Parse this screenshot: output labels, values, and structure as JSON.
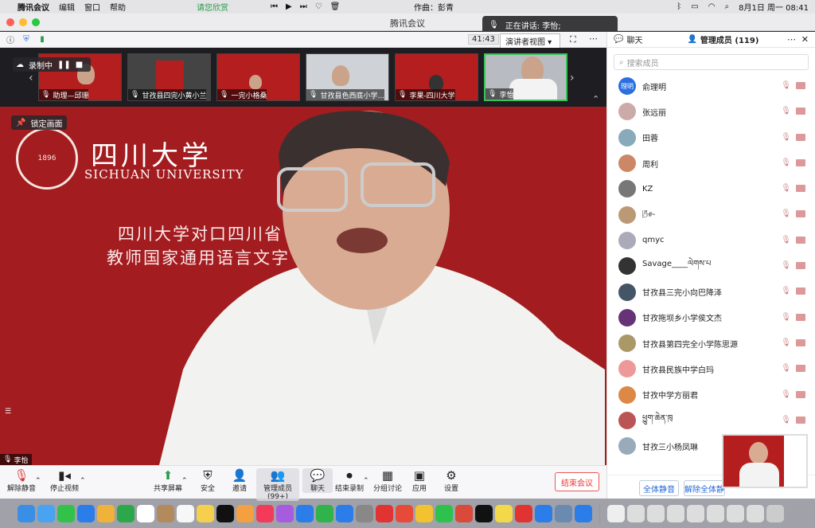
{
  "menubar": {
    "app": "腾讯会议",
    "menus": [
      "编辑",
      "窗口",
      "帮助"
    ],
    "center_text": "请您欣赏",
    "credit": "作曲：彭青",
    "date_time": "8月1日 周一  08:41"
  },
  "window": {
    "title": "腾讯会议",
    "speaking_label": "正在讲话: 李怡;",
    "timer": "41:43",
    "view_mode": "演讲者视图"
  },
  "recording": {
    "label": "录制中"
  },
  "thumbnails": [
    {
      "label": "助理—邱珊"
    },
    {
      "label": "甘孜县四完小黄小兰"
    },
    {
      "label": "一完小格桑"
    },
    {
      "label": "甘孜县色西底小学..."
    },
    {
      "label": "李果-四川大学"
    },
    {
      "label": "李怡"
    }
  ],
  "main": {
    "lock_label": "锁定画面",
    "university_cn": "四川大学",
    "university_en": "SICHUAN UNIVERSITY",
    "seal_year": "1896",
    "slide_line1": "四川大学对口四川省            甘孜县",
    "slide_line2": "教师国家通用语言文字            示范培训",
    "speaker_name": "李怡"
  },
  "toolbar": {
    "mute": "解除静音",
    "video": "停止视频",
    "share": "共享屏幕",
    "security": "安全",
    "invite": "邀请",
    "manage": "管理成员(99+)",
    "chat": "聊天",
    "end_record": "结束录制",
    "breakout": "分组讨论",
    "apps": "应用",
    "settings": "设置",
    "end_meeting": "结束会议"
  },
  "panel": {
    "tab_chat": "聊天",
    "tab_members": "管理成员 (119)",
    "search_placeholder": "搜索成员",
    "members": [
      {
        "name": "俞理明",
        "avatar_text": "理明",
        "color": "#2a6fe0"
      },
      {
        "name": "张远丽",
        "avatar_text": "",
        "color": "#caa"
      },
      {
        "name": "田蓉",
        "avatar_text": "",
        "color": "#8ab"
      },
      {
        "name": "周利",
        "avatar_text": "",
        "color": "#c86"
      },
      {
        "name": "KZ",
        "avatar_text": "",
        "color": "#777"
      },
      {
        "name": "🌬-",
        "avatar_text": "",
        "color": "#b97"
      },
      {
        "name": "qmyc",
        "avatar_text": "",
        "color": "#aab"
      },
      {
        "name": "Savage____ལེགས་པ",
        "avatar_text": "",
        "color": "#333"
      },
      {
        "name": "甘孜县三完小向巴降泽",
        "avatar_text": "",
        "color": "#456"
      },
      {
        "name": "甘孜拖坝乡小学侯文杰",
        "avatar_text": "",
        "color": "#637"
      },
      {
        "name": "甘孜县第四完全小学陈思源",
        "avatar_text": "",
        "color": "#a96"
      },
      {
        "name": "甘孜县民族中学白玛",
        "avatar_text": "",
        "color": "#e99"
      },
      {
        "name": "甘孜中学方丽君",
        "avatar_text": "",
        "color": "#d84"
      },
      {
        "name": "ཕྱུག་ཆེན་ཁུ",
        "avatar_text": "",
        "color": "#b55"
      },
      {
        "name": "甘孜三小杨凤琳",
        "avatar_text": "",
        "color": "#9ab"
      }
    ],
    "mute_all": "全体静音",
    "unmute_all": "解除全体静"
  },
  "colors": {
    "slide_red": "#a31c1f",
    "accent_blue": "#2468d8",
    "end_red": "#e33333"
  }
}
